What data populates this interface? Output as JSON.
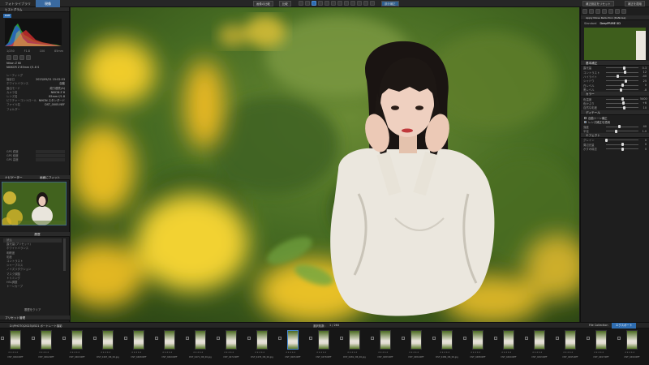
{
  "topbar": {
    "tab_library": "フォトライブラリ",
    "tab_develop": "現像",
    "btn_center_left": "画像の比較",
    "btn_center_mid": "比較",
    "btn_stamp": "部分補正",
    "btn_right": "補正を適用",
    "btn_right2": "補正設定をリセット"
  },
  "left": {
    "histogram_title": "ヒストグラム",
    "btn_rgb": "RGB",
    "exif": [
      {
        "k": "シャッター",
        "v": "1/250"
      },
      {
        "k": "絞り",
        "v": "F1.8"
      },
      {
        "k": "ISO",
        "v": "100"
      },
      {
        "k": "焦点距離",
        "v": "85mm"
      }
    ],
    "info_label_1": "Nikon Z 6II",
    "info_label_2": "NIKKOR Z 85mm f/1.8 S",
    "meta": [
      {
        "k": "レーティング",
        "v": ""
      },
      {
        "k": "撮影日",
        "v": "2023/05/21 15:02:53"
      },
      {
        "k": "ホワイトバランス",
        "v": "自動"
      },
      {
        "k": "露出モード",
        "v": "絞り優先(A)"
      },
      {
        "k": "カメラ名",
        "v": "NIKON Z 6"
      },
      {
        "k": "レンズ名",
        "v": "85mm f/1.8"
      },
      {
        "k": "ピクチャーコントロール",
        "v": "NIKON スタンダード"
      },
      {
        "k": "ファイル名",
        "v": "DST_0005.NEF"
      },
      {
        "k": "フォルダー",
        "v": ""
      }
    ],
    "gps": [
      {
        "k": "GPS 緯度",
        "v": ""
      },
      {
        "k": "GPS 経度",
        "v": ""
      },
      {
        "k": "GPS 高度",
        "v": ""
      }
    ],
    "navigator_title": "ナビゲーター",
    "navigator_zoom": "画面にフィット",
    "history_title": "履歴",
    "history_items": [
      "読込",
      "露光量(プリセット)",
      "ホワイトバランス",
      "明瞭度",
      "彩度",
      "コントラスト",
      "シャープネス",
      "ノイズリダクション",
      "マスク調整",
      "トリミング",
      "HSL調整",
      "トーンカーブ"
    ],
    "history_btn": "履歴をクリア",
    "bottom_title": "プリセット管理"
  },
  "right": {
    "header": "Apply Noise Reduction (DeNoise)",
    "radio_1": "Standard",
    "radio_2": "DeepPRIME XD",
    "basic_title": "基本補正",
    "sliders": [
      {
        "label": "露光量",
        "value": "0.3",
        "pos": 0.55
      },
      {
        "label": "コントラスト",
        "value": "12",
        "pos": 0.58
      },
      {
        "label": "ハイライト",
        "value": "-40",
        "pos": 0.35
      },
      {
        "label": "シャドウ",
        "value": "25",
        "pos": 0.62
      },
      {
        "label": "白レベル",
        "value": "0",
        "pos": 0.5
      },
      {
        "label": "黒レベル",
        "value": "-8",
        "pos": 0.46
      }
    ],
    "color_title": "カラー",
    "color_sliders": [
      {
        "label": "色温度",
        "value": "5400",
        "pos": 0.52
      },
      {
        "label": "色かぶり",
        "value": "+6",
        "pos": 0.53
      },
      {
        "label": "自然な彩度",
        "value": "10",
        "pos": 0.56
      }
    ],
    "detail_title": "ディテール",
    "checkbox_1": "自動トーン補正",
    "checkbox_2": "レンズ補正を適用",
    "detail_sliders": [
      {
        "label": "強度",
        "value": "40",
        "pos": 0.4
      },
      {
        "label": "半径",
        "value": "1.0",
        "pos": 0.3
      }
    ],
    "effects_title": "エフェクト",
    "effects_sliders": [
      {
        "label": "グレイン",
        "value": "0",
        "pos": 0.0
      },
      {
        "label": "周辺光量",
        "value": "0",
        "pos": 0.5
      },
      {
        "label": "かすみ除去",
        "value": "0",
        "pos": 0.5
      }
    ]
  },
  "filmbar": {
    "path": "D:\\PHOTO\\2023\\0521 ポートレート撮影",
    "count_label": "選択枚数：",
    "count": "1 / 264",
    "collection": "File Collection",
    "export": "エクスポート"
  },
  "thumbs": [
    {
      "name": "DST_0460.NEF"
    },
    {
      "name": "DST_0462.NEF"
    },
    {
      "name": "DST_0463.NEF"
    },
    {
      "name": "DST_0467_DR_06.jpg"
    },
    {
      "name": "DST_0468.NEF"
    },
    {
      "name": "DST_0469.NEF"
    },
    {
      "name": "DST_0471_DR_06.jpg"
    },
    {
      "name": "DST_0472.NEF"
    },
    {
      "name": "DST_0476_DR_06.jpg"
    },
    {
      "name": "DST_0005.NEF"
    },
    {
      "name": "DST_0478.NEF"
    },
    {
      "name": "DST_0481_DR_06.jpg"
    },
    {
      "name": "DST_0483.NEF"
    },
    {
      "name": "DST_0484.NEF"
    },
    {
      "name": "DST_0486_DR_06.jpg"
    },
    {
      "name": "DST_0488.NEF"
    },
    {
      "name": "DST_0490.NEF"
    },
    {
      "name": "DST_0493.NEF"
    },
    {
      "name": "DST_0495.NEF"
    },
    {
      "name": "DST_0497.NEF"
    },
    {
      "name": "DST_0499.NEF"
    }
  ]
}
